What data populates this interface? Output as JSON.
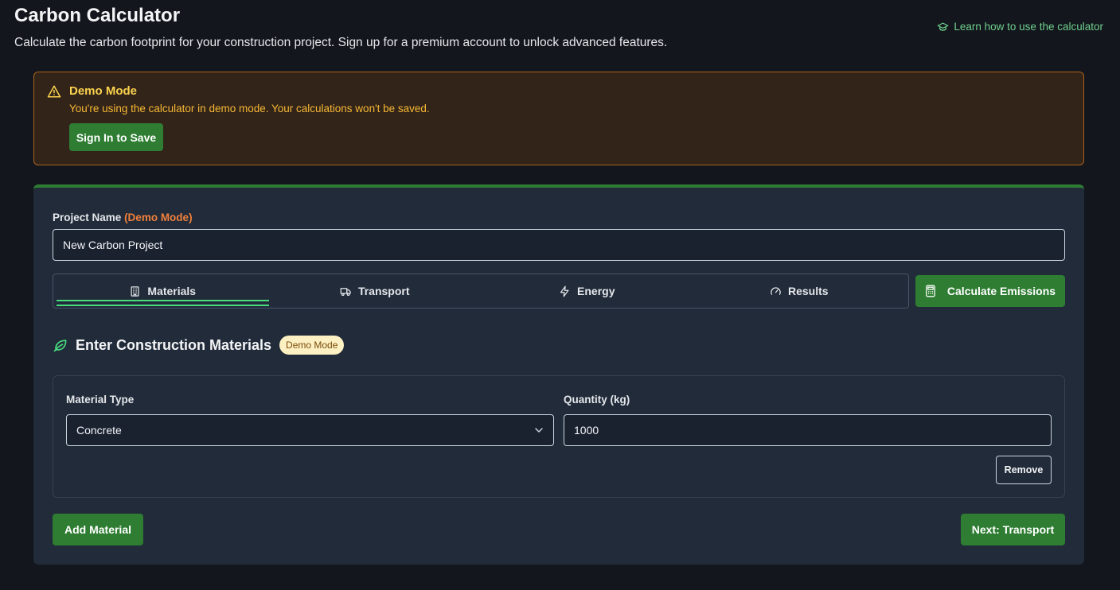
{
  "header": {
    "title": "Carbon Calculator",
    "subtitle": "Calculate the carbon footprint for your construction project. Sign up for a premium account to unlock advanced features.",
    "learn_link": "Learn how to use the calculator"
  },
  "demo_banner": {
    "title": "Demo Mode",
    "text": "You're using the calculator in demo mode. Your calculations won't be saved.",
    "button": "Sign In to Save"
  },
  "project": {
    "label": "Project Name",
    "label_tag": "(Demo Mode)",
    "value": "New Carbon Project"
  },
  "tabs": [
    {
      "label": "Materials",
      "icon": "building-icon",
      "active": true
    },
    {
      "label": "Transport",
      "icon": "truck-icon",
      "active": false
    },
    {
      "label": "Energy",
      "icon": "bolt-icon",
      "active": false
    },
    {
      "label": "Results",
      "icon": "gauge-icon",
      "active": false
    }
  ],
  "calculate_button": "Calculate Emissions",
  "section": {
    "title": "Enter Construction Materials",
    "badge": "Demo Mode",
    "icon": "leaf-icon"
  },
  "material_row": {
    "type_label": "Material Type",
    "type_value": "Concrete",
    "quantity_label": "Quantity (kg)",
    "quantity_value": "1000",
    "remove_button": "Remove"
  },
  "actions": {
    "add_button": "Add Material",
    "next_button": "Next: Transport"
  },
  "colors": {
    "accent_green": "#2e7d32",
    "warning_border": "#a8621d",
    "warning_text": "#f6b833",
    "link_green": "#6fcf8e"
  }
}
